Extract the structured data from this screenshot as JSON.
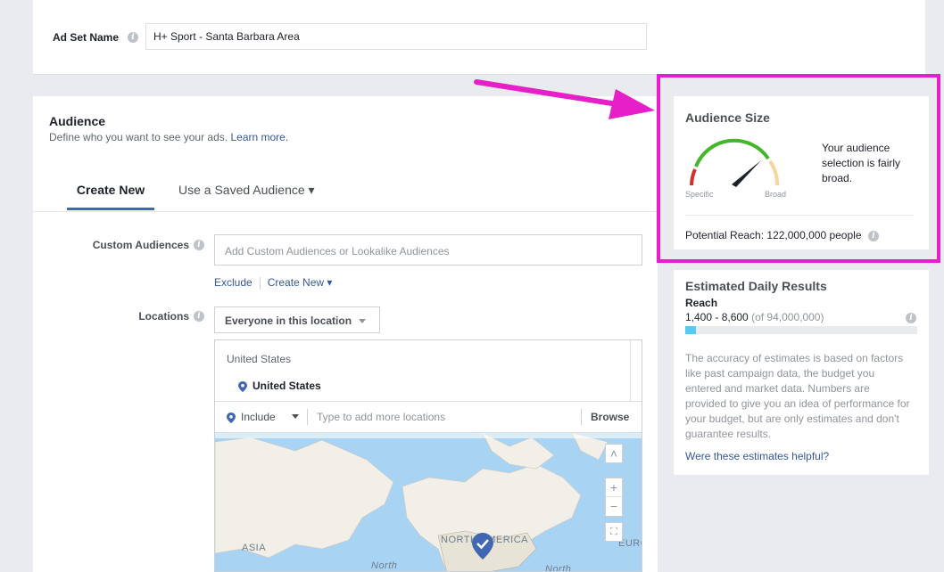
{
  "adset": {
    "label": "Ad Set Name",
    "value": "H+ Sport - Santa Barbara Area"
  },
  "audience": {
    "title": "Audience",
    "subtitle": "Define who you want to see your ads.",
    "learn_more": "Learn more.",
    "tabs": [
      {
        "label": "Create New",
        "active": true
      },
      {
        "label": "Use a Saved Audience ▾",
        "active": false
      }
    ],
    "custom_audiences": {
      "label": "Custom Audiences",
      "placeholder": "Add Custom Audiences or Lookalike Audiences",
      "exclude": "Exclude",
      "create_new": "Create New ▾"
    },
    "locations": {
      "label": "Locations",
      "dropdown": "Everyone in this location",
      "group_header": "United States",
      "selected": "United States",
      "include": "Include",
      "placeholder": "Type to add more locations",
      "browse": "Browse",
      "map_labels": {
        "asia": "ASIA",
        "north_america": "NORTH AMERICA",
        "north": "North",
        "north2": "North",
        "europe": "EURO"
      },
      "map_controls": {
        "up": "˄",
        "zoom_in": "+",
        "zoom_out": "−",
        "fit": "⛶"
      }
    }
  },
  "audience_size": {
    "title": "Audience Size",
    "specific": "Specific",
    "broad": "Broad",
    "description": "Your audience selection is fairly broad.",
    "potential_reach": "Potential Reach: 122,000,000 people"
  },
  "estimated": {
    "title": "Estimated Daily Results",
    "reach_label": "Reach",
    "range": "1,400 - 8,600",
    "of_total": "(of 94,000,000)",
    "bar_fraction": 0.045,
    "description": "The accuracy of estimates is based on factors like past campaign data, the budget you entered and market data. Numbers are provided to give you an idea of performance for your budget, but are only estimates and don't guarantee results.",
    "helpful_link": "Were these estimates helpful?"
  },
  "colors": {
    "accent": "#4267b2",
    "highlight": "#e61fc8",
    "link": "#365899"
  }
}
